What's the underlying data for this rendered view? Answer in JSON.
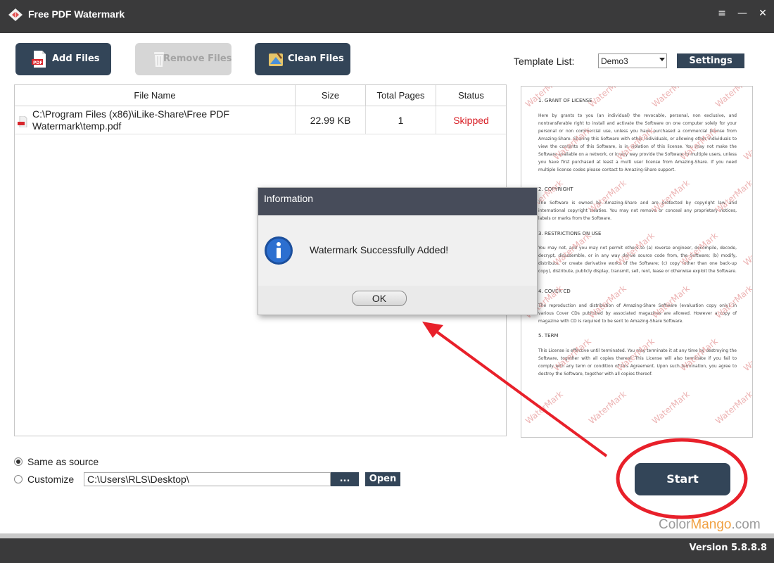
{
  "window": {
    "title": "Free PDF Watermark",
    "controls": [
      "≡",
      "—",
      "✕"
    ]
  },
  "toolbar": {
    "add_files": "Add Files",
    "remove_files": "Remove Files",
    "clean_files": "Clean Files"
  },
  "template": {
    "label": "Template List:",
    "selected": "Demo3",
    "settings": "Settings"
  },
  "table": {
    "headers": [
      "File Name",
      "Size",
      "Total Pages",
      "Status"
    ],
    "rows": [
      {
        "file_name": "C:\\Program Files (x86)\\iLike-Share\\Free PDF Watermark\\temp.pdf",
        "size": "22.99 KB",
        "pages": "1",
        "status": "Skipped"
      }
    ]
  },
  "preview": {
    "sections": [
      {
        "heading": "1. GRANT OF LICENSE",
        "text": "Here by grants to you (an individual) the revocable, personal, non exclusive, and nontransferable right to install and activate the Software on one computer solely for your personal or non commercial use, unless you have purchased a commercial license from Amazing-Share. Sharing this Software with other individuals, or allowing other individuals to view the contents of this Software, is in violation of this license. You may not make the Software available on a network, or in any way provide the Software to multiple users, unless you have first purchased at least a multi user license from Amazing-Share. If you need multiple license codes please contact to Amazing-Share support."
      },
      {
        "heading": "2. COPYRIGHT",
        "text": "The Software is owned by Amazing-Share and are protected by copyright law and international copyright treaties. You may not remove or conceal any proprietary notices, labels or marks from the Software."
      },
      {
        "heading": "3. RESTRICTIONS ON USE",
        "text": "You may not, and you may not permit others to (a) reverse engineer, decompile, decode, decrypt, disassemble, or in any way derive source code from, the Software; (b) modify, distribute, or create derivative works of the Software; (c) copy (other than one back-up copy), distribute, publicly display, transmit, sell, rent, lease or otherwise exploit the Software."
      },
      {
        "heading": "4. COVER CD",
        "text": "The reproduction and distribution of Amazing-Share Software (evaluation copy only) in various Cover CDs published by associated magazines are allowed. However a copy of magazine with CD is required to be sent to Amazing-Share Software."
      },
      {
        "heading": "5. TERM",
        "text": "This License is effective until terminated. You may terminate it at any time by destroying the Software, together with all copies thereof. This License will also terminate if you fail to comply with any term or condition of this Agreement. Upon such termination, you agree to destroy the Software, together with all copies thereof."
      }
    ],
    "watermark_text": "WaterMark",
    "watermark_color": "#e8a0a0"
  },
  "output": {
    "same_as_source": "Same as source",
    "customize": "Customize",
    "path": "C:\\Users\\RLS\\Desktop\\",
    "browse": "...",
    "open": "Open",
    "selected": "same_as_source"
  },
  "start": "Start",
  "footer": {
    "brand_part1": "Color",
    "brand_part2": "Mango",
    "brand_part3": ".com",
    "version": "Version 5.8.8.8"
  },
  "dialog": {
    "title": "Information",
    "message": "Watermark Successfully Added!",
    "ok": "OK"
  },
  "colors": {
    "accent": "#334558",
    "titlebar": "#3a3a3b",
    "status_skipped": "#d81f26",
    "annotation": "#e8202a"
  }
}
